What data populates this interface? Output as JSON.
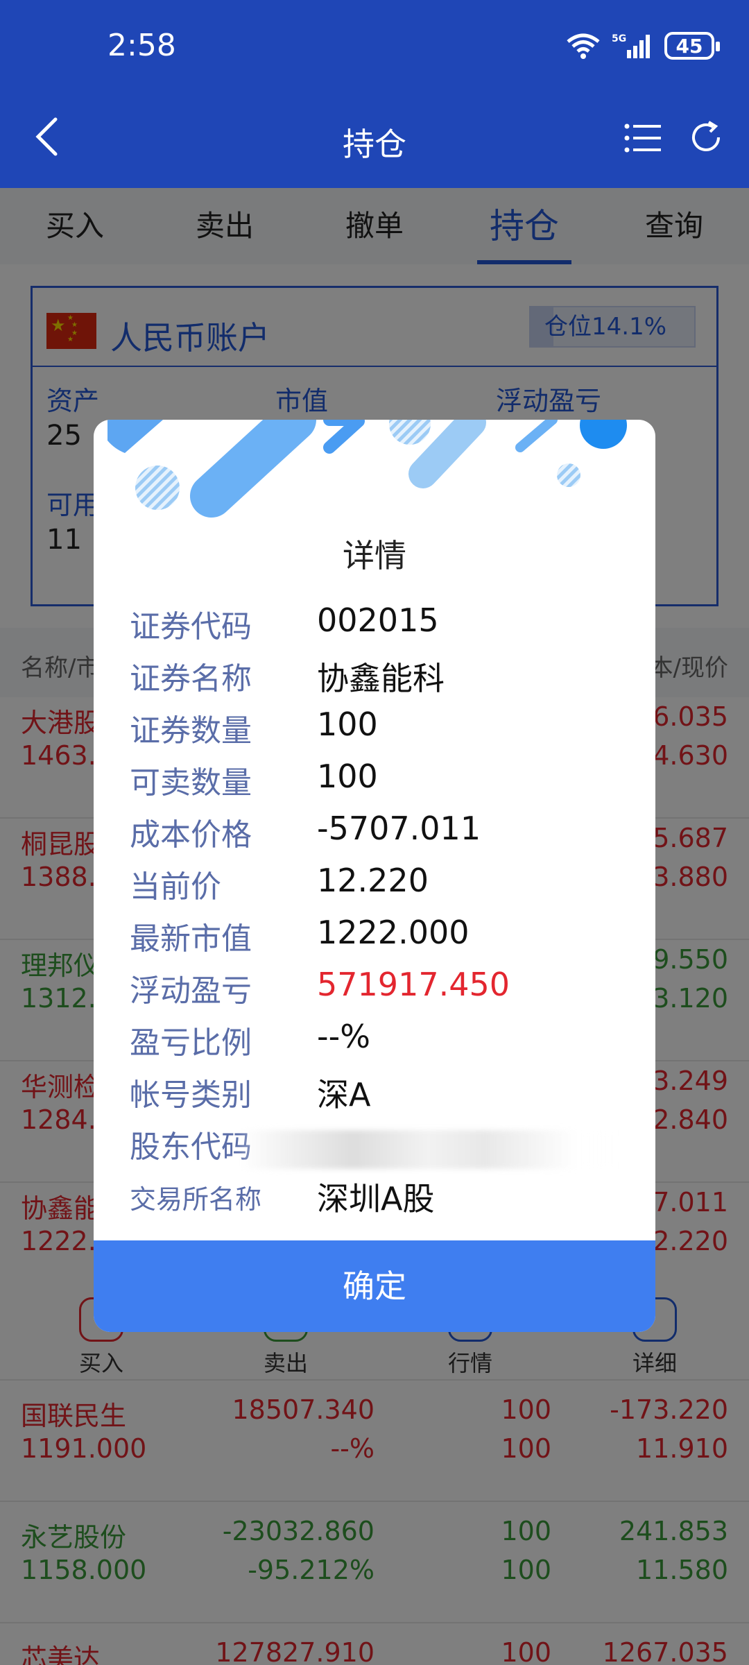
{
  "status_bar": {
    "time": "2:58",
    "battery": "45",
    "network": "5G"
  },
  "nav": {
    "title": "持仓"
  },
  "tabs": [
    {
      "label": "买入",
      "active": false
    },
    {
      "label": "卖出",
      "active": false
    },
    {
      "label": "撤单",
      "active": false
    },
    {
      "label": "持仓",
      "active": true
    },
    {
      "label": "查询",
      "active": false
    }
  ],
  "account": {
    "title": "人民币账户",
    "position_label": "仓位14.1%",
    "position_ratio": 0.141,
    "label_assets": "资产",
    "label_market_value": "市值",
    "label_floating_pnl": "浮动盈亏",
    "assets_value_partial": "25",
    "available_label_partial": "可用",
    "available_value_partial": "11"
  },
  "list_header": {
    "left": "名称/市",
    "right": "本/现价"
  },
  "holdings": [
    {
      "name": "大港股",
      "sub": "1463.",
      "right1": "6.035",
      "right2": "4.630",
      "color": "red"
    },
    {
      "name": "桐昆股",
      "sub": "1388.",
      "right1": "5.687",
      "right2": "3.880",
      "color": "red"
    },
    {
      "name": "理邦仪",
      "sub": "1312.",
      "right1": "9.550",
      "right2": "3.120",
      "color": "green"
    },
    {
      "name": "华测检",
      "sub": "1284.",
      "right1": "3.249",
      "right2": "2.840",
      "color": "red"
    },
    {
      "name": "协鑫能",
      "sub": "1222.",
      "right1": "7.011",
      "right2": "2.220",
      "color": "red"
    }
  ],
  "actions": [
    {
      "label": "买入",
      "color": "#e3262f"
    },
    {
      "label": "卖出",
      "color": "#3b9a3b"
    },
    {
      "label": "行情",
      "color": "#2459d6"
    },
    {
      "label": "详细",
      "color": "#2459d6"
    }
  ],
  "rows_below": [
    {
      "name": "国联民生",
      "value": "1191.000",
      "pnl": "18507.340",
      "pnl_pct": "--%",
      "qty1": "100",
      "qty2": "100",
      "cost": "-173.220",
      "price": "11.910",
      "color": "red"
    },
    {
      "name": "永艺股份",
      "value": "1158.000",
      "pnl": "-23032.860",
      "pnl_pct": "-95.212%",
      "qty1": "100",
      "qty2": "100",
      "cost": "241.853",
      "price": "11.580",
      "color": "green"
    },
    {
      "name": "芯美达",
      "value": "",
      "pnl": "127827.910",
      "pnl_pct": "",
      "qty1": "100",
      "qty2": "",
      "cost": "1267.035",
      "price": "",
      "color": "red"
    }
  ],
  "dialog": {
    "title": "详情",
    "fields": [
      {
        "label": "证券代码",
        "value": "002015"
      },
      {
        "label": "证券名称",
        "value": "协鑫能科"
      },
      {
        "label": "证券数量",
        "value": "100"
      },
      {
        "label": "可卖数量",
        "value": "100"
      },
      {
        "label": "成本价格",
        "value": "-5707.011"
      },
      {
        "label": "当前价",
        "value": "12.220"
      },
      {
        "label": "最新市值",
        "value": "1222.000"
      },
      {
        "label": "浮动盈亏",
        "value": "571917.450",
        "highlight": "red"
      },
      {
        "label": "盈亏比例",
        "value": "--%"
      },
      {
        "label": "帐号类别",
        "value": "深A"
      },
      {
        "label": "股东代码",
        "value": "",
        "masked": true
      },
      {
        "label": "交易所名称",
        "value": "深圳A股"
      }
    ],
    "confirm_label": "确定"
  }
}
